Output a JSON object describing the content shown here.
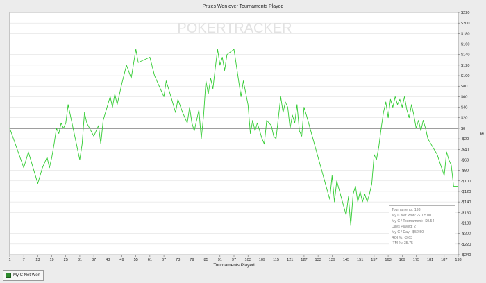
{
  "title": "Prizes Won over Tournaments Played",
  "watermark": {
    "part1": "PO",
    "part2": "KER",
    "part3": "TRACKER"
  },
  "stats": [
    "Tournaments: 193",
    "My C Net Won: -$105.00",
    "My C / Tournament: -$0.54",
    "Days Played: 2",
    "My C / Day: -$52.50",
    "ROI %: -3.63",
    "ITM %: 35.75"
  ],
  "legend": {
    "label": "My C Net Won",
    "color": "#2e8b2e"
  },
  "colors": {
    "line": "#33cc33",
    "zero": "#000000",
    "grid": "#d0d0d0",
    "plot_bg": "#ffffff"
  },
  "chart_data": {
    "type": "line",
    "title": "Prizes Won over Tournaments Played",
    "xlabel": "Tournaments Played",
    "ylabel": "$",
    "xlim": [
      1,
      193
    ],
    "ylim": [
      -240,
      220
    ],
    "x_ticks": [
      1,
      7,
      13,
      19,
      25,
      31,
      37,
      43,
      49,
      55,
      61,
      67,
      73,
      79,
      85,
      91,
      97,
      103,
      109,
      115,
      121,
      127,
      133,
      139,
      145,
      151,
      157,
      163,
      169,
      175,
      181,
      187,
      193
    ],
    "y_ticks": [
      220,
      200,
      180,
      160,
      140,
      120,
      100,
      80,
      60,
      40,
      20,
      0,
      -20,
      -40,
      -60,
      -80,
      -100,
      -120,
      -140,
      -160,
      -180,
      -200,
      -220,
      -240
    ],
    "y_tick_labels": [
      "$220",
      "$200",
      "$180",
      "$160",
      "$140",
      "$120",
      "$100",
      "$80",
      "$60",
      "$40",
      "$20",
      "$0",
      "-$20",
      "-$40",
      "-$60",
      "-$80",
      "-$100",
      "-$120",
      "-$140",
      "-$160",
      "-$180",
      "-$200",
      "-$220",
      "-$240"
    ],
    "grid": true,
    "legend_position": "bottom-left",
    "series": [
      {
        "name": "My C Net Won",
        "x": [
          1,
          7,
          9,
          13,
          15,
          17,
          18,
          19,
          20,
          21,
          22,
          23,
          24,
          25,
          26,
          31,
          32,
          33,
          34,
          37,
          39,
          40,
          41,
          42,
          44,
          45,
          46,
          47,
          49,
          51,
          53,
          55,
          56,
          61,
          63,
          65,
          67,
          68,
          70,
          72,
          73,
          75,
          77,
          78,
          79,
          80,
          82,
          83,
          84,
          85,
          86,
          87,
          88,
          89,
          90,
          91,
          92,
          93,
          94,
          97,
          100,
          101,
          103,
          104,
          105,
          106,
          107,
          109,
          110,
          111,
          113,
          114,
          115,
          117,
          118,
          119,
          120,
          121,
          122,
          123,
          124,
          125,
          126,
          127,
          128,
          138,
          139,
          140,
          141,
          145,
          146,
          147,
          148,
          149,
          150,
          151,
          152,
          153,
          154,
          155,
          156,
          157,
          158,
          159,
          160,
          161,
          162,
          163,
          164,
          165,
          166,
          167,
          168,
          169,
          170,
          171,
          172,
          173,
          174,
          175,
          176,
          177,
          178,
          179,
          180,
          184,
          187,
          188,
          189,
          190,
          191,
          193
        ],
        "y": [
          0,
          -75,
          -45,
          -105,
          -75,
          -55,
          -75,
          -55,
          -30,
          0,
          -10,
          10,
          0,
          10,
          45,
          -60,
          -30,
          30,
          10,
          -15,
          5,
          -30,
          15,
          30,
          60,
          40,
          65,
          45,
          85,
          120,
          95,
          150,
          125,
          135,
          100,
          80,
          60,
          90,
          60,
          30,
          55,
          30,
          10,
          40,
          10,
          -5,
          35,
          -20,
          25,
          90,
          65,
          95,
          75,
          115,
          150,
          120,
          135,
          110,
          140,
          150,
          60,
          90,
          45,
          -10,
          15,
          -5,
          10,
          -20,
          -30,
          15,
          5,
          -15,
          -20,
          60,
          30,
          50,
          40,
          0,
          25,
          10,
          45,
          -5,
          -15,
          40,
          25,
          -135,
          -90,
          -140,
          -100,
          -165,
          -130,
          -185,
          -125,
          -110,
          -140,
          -120,
          -140,
          -125,
          -140,
          -125,
          -105,
          -50,
          -60,
          -35,
          0,
          30,
          50,
          20,
          55,
          40,
          60,
          45,
          55,
          40,
          60,
          35,
          20,
          45,
          25,
          0,
          15,
          -5,
          15,
          0,
          -20,
          -50,
          -90,
          -45,
          -60,
          -70,
          -110,
          -110
        ]
      }
    ]
  }
}
